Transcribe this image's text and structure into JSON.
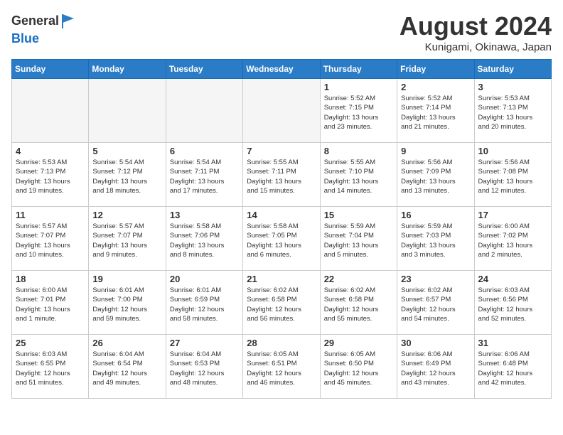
{
  "header": {
    "logo_line1": "General",
    "logo_line2": "Blue",
    "month_title": "August 2024",
    "location": "Kunigami, Okinawa, Japan"
  },
  "days_of_week": [
    "Sunday",
    "Monday",
    "Tuesday",
    "Wednesday",
    "Thursday",
    "Friday",
    "Saturday"
  ],
  "weeks": [
    [
      {
        "day": "",
        "info": ""
      },
      {
        "day": "",
        "info": ""
      },
      {
        "day": "",
        "info": ""
      },
      {
        "day": "",
        "info": ""
      },
      {
        "day": "1",
        "info": "Sunrise: 5:52 AM\nSunset: 7:15 PM\nDaylight: 13 hours\nand 23 minutes."
      },
      {
        "day": "2",
        "info": "Sunrise: 5:52 AM\nSunset: 7:14 PM\nDaylight: 13 hours\nand 21 minutes."
      },
      {
        "day": "3",
        "info": "Sunrise: 5:53 AM\nSunset: 7:13 PM\nDaylight: 13 hours\nand 20 minutes."
      }
    ],
    [
      {
        "day": "4",
        "info": "Sunrise: 5:53 AM\nSunset: 7:13 PM\nDaylight: 13 hours\nand 19 minutes."
      },
      {
        "day": "5",
        "info": "Sunrise: 5:54 AM\nSunset: 7:12 PM\nDaylight: 13 hours\nand 18 minutes."
      },
      {
        "day": "6",
        "info": "Sunrise: 5:54 AM\nSunset: 7:11 PM\nDaylight: 13 hours\nand 17 minutes."
      },
      {
        "day": "7",
        "info": "Sunrise: 5:55 AM\nSunset: 7:11 PM\nDaylight: 13 hours\nand 15 minutes."
      },
      {
        "day": "8",
        "info": "Sunrise: 5:55 AM\nSunset: 7:10 PM\nDaylight: 13 hours\nand 14 minutes."
      },
      {
        "day": "9",
        "info": "Sunrise: 5:56 AM\nSunset: 7:09 PM\nDaylight: 13 hours\nand 13 minutes."
      },
      {
        "day": "10",
        "info": "Sunrise: 5:56 AM\nSunset: 7:08 PM\nDaylight: 13 hours\nand 12 minutes."
      }
    ],
    [
      {
        "day": "11",
        "info": "Sunrise: 5:57 AM\nSunset: 7:07 PM\nDaylight: 13 hours\nand 10 minutes."
      },
      {
        "day": "12",
        "info": "Sunrise: 5:57 AM\nSunset: 7:07 PM\nDaylight: 13 hours\nand 9 minutes."
      },
      {
        "day": "13",
        "info": "Sunrise: 5:58 AM\nSunset: 7:06 PM\nDaylight: 13 hours\nand 8 minutes."
      },
      {
        "day": "14",
        "info": "Sunrise: 5:58 AM\nSunset: 7:05 PM\nDaylight: 13 hours\nand 6 minutes."
      },
      {
        "day": "15",
        "info": "Sunrise: 5:59 AM\nSunset: 7:04 PM\nDaylight: 13 hours\nand 5 minutes."
      },
      {
        "day": "16",
        "info": "Sunrise: 5:59 AM\nSunset: 7:03 PM\nDaylight: 13 hours\nand 3 minutes."
      },
      {
        "day": "17",
        "info": "Sunrise: 6:00 AM\nSunset: 7:02 PM\nDaylight: 13 hours\nand 2 minutes."
      }
    ],
    [
      {
        "day": "18",
        "info": "Sunrise: 6:00 AM\nSunset: 7:01 PM\nDaylight: 13 hours\nand 1 minute."
      },
      {
        "day": "19",
        "info": "Sunrise: 6:01 AM\nSunset: 7:00 PM\nDaylight: 12 hours\nand 59 minutes."
      },
      {
        "day": "20",
        "info": "Sunrise: 6:01 AM\nSunset: 6:59 PM\nDaylight: 12 hours\nand 58 minutes."
      },
      {
        "day": "21",
        "info": "Sunrise: 6:02 AM\nSunset: 6:58 PM\nDaylight: 12 hours\nand 56 minutes."
      },
      {
        "day": "22",
        "info": "Sunrise: 6:02 AM\nSunset: 6:58 PM\nDaylight: 12 hours\nand 55 minutes."
      },
      {
        "day": "23",
        "info": "Sunrise: 6:02 AM\nSunset: 6:57 PM\nDaylight: 12 hours\nand 54 minutes."
      },
      {
        "day": "24",
        "info": "Sunrise: 6:03 AM\nSunset: 6:56 PM\nDaylight: 12 hours\nand 52 minutes."
      }
    ],
    [
      {
        "day": "25",
        "info": "Sunrise: 6:03 AM\nSunset: 6:55 PM\nDaylight: 12 hours\nand 51 minutes."
      },
      {
        "day": "26",
        "info": "Sunrise: 6:04 AM\nSunset: 6:54 PM\nDaylight: 12 hours\nand 49 minutes."
      },
      {
        "day": "27",
        "info": "Sunrise: 6:04 AM\nSunset: 6:53 PM\nDaylight: 12 hours\nand 48 minutes."
      },
      {
        "day": "28",
        "info": "Sunrise: 6:05 AM\nSunset: 6:51 PM\nDaylight: 12 hours\nand 46 minutes."
      },
      {
        "day": "29",
        "info": "Sunrise: 6:05 AM\nSunset: 6:50 PM\nDaylight: 12 hours\nand 45 minutes."
      },
      {
        "day": "30",
        "info": "Sunrise: 6:06 AM\nSunset: 6:49 PM\nDaylight: 12 hours\nand 43 minutes."
      },
      {
        "day": "31",
        "info": "Sunrise: 6:06 AM\nSunset: 6:48 PM\nDaylight: 12 hours\nand 42 minutes."
      }
    ]
  ]
}
